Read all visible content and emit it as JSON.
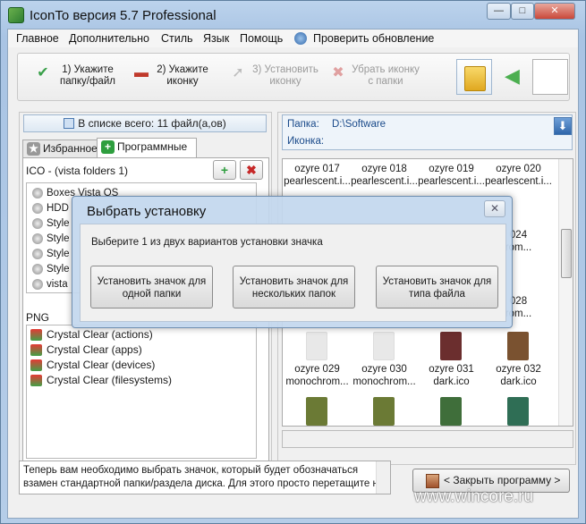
{
  "window": {
    "title": "IconTo версия 5.7 Professional",
    "minimize": "—",
    "maximize": "□",
    "close": "✕"
  },
  "menu": {
    "items": [
      "Главное",
      "Дополнительно",
      "Стиль",
      "Язык",
      "Помощь"
    ],
    "update": "Проверить обновление"
  },
  "steps": [
    {
      "label": "1) Укажите\nпапку/файл",
      "icon": "check-icon",
      "enabled": true
    },
    {
      "label": "2) Укажите\nиконку",
      "icon": "minus-icon",
      "enabled": true
    },
    {
      "label": "3) Установить\nиконку",
      "icon": "install-icon",
      "enabled": false
    },
    {
      "label": "Убрать иконку\nс папки",
      "icon": "remove-icon",
      "enabled": false
    }
  ],
  "left": {
    "count": "В списке всего: 11 файл(а,ов)",
    "tabs": [
      "Избранное",
      "Программные"
    ],
    "ico_group": "ICO - (vista folders 1)",
    "ico_items": [
      "Boxes Vista OS",
      "HDD",
      "Style",
      "Style",
      "Style",
      "Style",
      "vista"
    ],
    "png_group": "PNG",
    "png_items": [
      "Crystal Clear (actions)",
      "Crystal Clear (apps)",
      "Crystal Clear (devices)",
      "Crystal Clear (filesystems)"
    ]
  },
  "right": {
    "folder_label": "Папка:",
    "folder_value": "D:\\Software",
    "icon_label": "Иконка:",
    "grid": [
      {
        "name": "ozyre 017",
        "sub": "pearlescent.i..."
      },
      {
        "name": "ozyre 018",
        "sub": "pearlescent.i..."
      },
      {
        "name": "ozyre 019",
        "sub": "pearlescent.i..."
      },
      {
        "name": "ozyre 020",
        "sub": "pearlescent.i..."
      },
      {
        "name": "024",
        "sub": "rom..."
      },
      {
        "name": "028",
        "sub": "rom..."
      },
      {
        "name": "ozyre 029",
        "sub": "monochrom..."
      },
      {
        "name": "ozyre 030",
        "sub": "monochrom..."
      },
      {
        "name": "ozyre 031",
        "sub": "dark.ico"
      },
      {
        "name": "ozyre 032",
        "sub": "dark.ico"
      }
    ],
    "colors": {
      "white": "#e8e8e8",
      "dark": "#6b2e2e",
      "brown": "#7a5230",
      "olive": "#6b7a35",
      "green": "#3f6e3a",
      "teal": "#2f6e55"
    }
  },
  "hint": {
    "line1": "Теперь вам необходимо выбрать значок, который будет обозначаться",
    "line2": "взамен стандартной папки/раздела диска. Для этого просто перетащите на"
  },
  "close_program": "< Закрыть программу >",
  "watermark": "www.wincore.ru",
  "dialog": {
    "title": "Выбрать установку",
    "close": "✕",
    "message": "Выберите 1 из двух вариантов установки значка",
    "buttons": [
      "Установить значок для\nодной папки",
      "Установить значок для\nнескольких папок",
      "Установить значок для\nтипа файла"
    ]
  }
}
